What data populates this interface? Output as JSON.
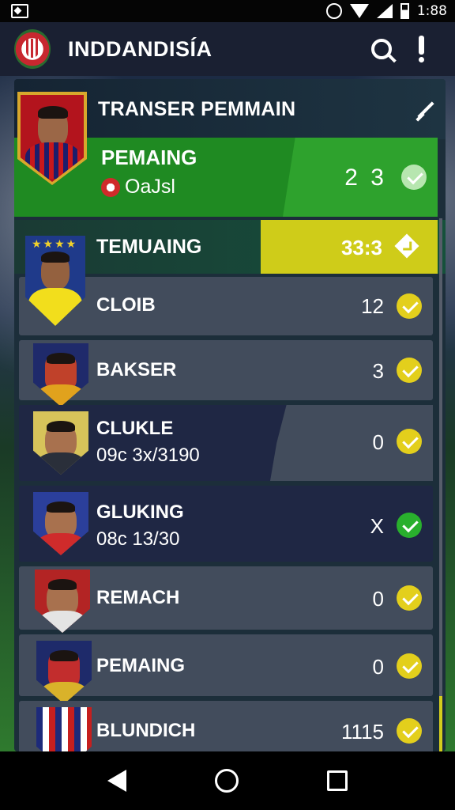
{
  "status_bar": {
    "time": "1:88"
  },
  "app_bar": {
    "title": "INDDANDISÍA"
  },
  "panel": {
    "title": "TRANSER PEMMAIN"
  },
  "featured": [
    {
      "name": "PEMAING",
      "sub": "OaJsl",
      "value": "2 3"
    },
    {
      "name": "TEMUAING",
      "value": "33:3"
    }
  ],
  "players": [
    {
      "name": "CLOIB",
      "sub": "",
      "value": "12",
      "check": "yellow"
    },
    {
      "name": "BAKSER",
      "sub": "",
      "value": "3",
      "check": "yellow"
    },
    {
      "name": "CLUKLE",
      "sub": "09c 3x/3190",
      "value": "0",
      "check": "yellow"
    },
    {
      "name": "GLUKING",
      "sub": "08c 13/30",
      "value": "X",
      "check": "green"
    },
    {
      "name": "REMACH",
      "sub": "",
      "value": "0",
      "check": "yellow"
    },
    {
      "name": "PEMAING",
      "sub": "",
      "value": "0",
      "check": "yellow"
    },
    {
      "name": "BLUNDICH",
      "sub": "",
      "value": "1115",
      "check": "yellow"
    }
  ]
}
